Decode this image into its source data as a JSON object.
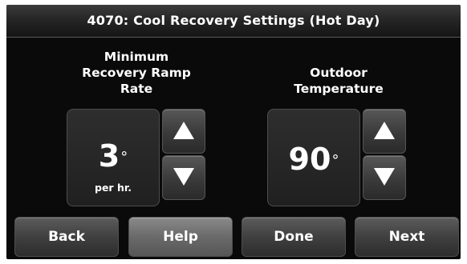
{
  "header": {
    "title": "4070: Cool Recovery Settings (Hot Day)"
  },
  "settings": [
    {
      "label": "Minimum\nRecovery Ramp\nRate",
      "label_lines": [
        "Minimum",
        "Recovery Ramp",
        "Rate"
      ],
      "value": "3",
      "degree": "°",
      "unit": "per hr."
    },
    {
      "label_lines": [
        "Outdoor",
        "Temperature"
      ],
      "value": "90",
      "degree": "°",
      "unit": ""
    }
  ],
  "icons": {
    "up": "up-arrow-icon",
    "down": "down-arrow-icon"
  },
  "footer": {
    "back_label": "Back",
    "help_label": "Help",
    "done_label": "Done",
    "next_label": "Next"
  },
  "colors": {
    "background": "#0a0a0a",
    "text": "#ffffff",
    "button": "#404040",
    "help_button": "#6a6a6a"
  }
}
